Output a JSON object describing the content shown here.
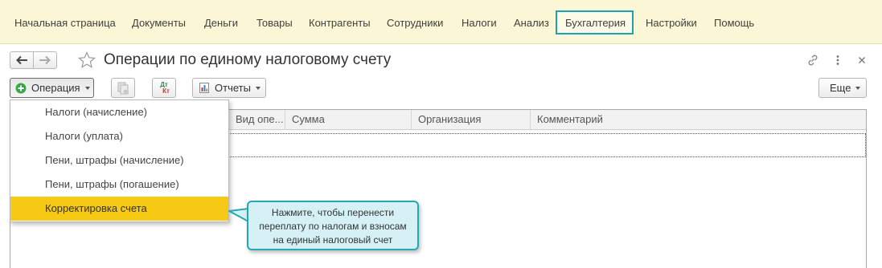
{
  "top_menu": {
    "items": [
      {
        "label": "Начальная страница"
      },
      {
        "label": "Документы"
      },
      {
        "label": "Деньги"
      },
      {
        "label": "Товары"
      },
      {
        "label": "Контрагенты"
      },
      {
        "label": "Сотрудники"
      },
      {
        "label": "Налоги"
      },
      {
        "label": "Анализ"
      },
      {
        "label": "Бухгалтерия",
        "active": true
      },
      {
        "label": "Настройки"
      },
      {
        "label": "Помощь"
      }
    ]
  },
  "window": {
    "title": "Операции по единому налоговому счету"
  },
  "toolbar": {
    "operation_label": "Операция",
    "reports_label": "Отчеты",
    "more_label": "Еще",
    "dt_label": "Дт",
    "kt_label": "Кт"
  },
  "table": {
    "columns": [
      "Вид опе...",
      "Сумма",
      "Организация",
      "Комментарий"
    ]
  },
  "dropdown": {
    "items": [
      {
        "label": "Налоги (начисление)"
      },
      {
        "label": "Налоги (уплата)"
      },
      {
        "label": "Пени, штрафы (начисление)"
      },
      {
        "label": "Пени, штрафы (погашение)"
      },
      {
        "label": "Корректировка счета",
        "highlighted": true
      }
    ]
  },
  "callout": {
    "lines": [
      "Нажмите, чтобы перенести",
      "переплату по налогам и взносам",
      "на единый налоговый счет"
    ]
  },
  "colors": {
    "topbar_bg": "#fbf6d5",
    "active_menu_border": "#1aa3b5",
    "highlight": "#f6c915",
    "callout_bg": "#d5f1f5",
    "callout_border": "#23a8b5",
    "add_icon_green": "#3aa64a"
  },
  "icons": [
    "back-arrow-icon",
    "forward-arrow-icon",
    "star-icon",
    "link-icon",
    "more-vertical-icon",
    "close-icon",
    "plus-circle-icon",
    "copy-document-icon",
    "dt-kt-icon",
    "report-icon"
  ]
}
